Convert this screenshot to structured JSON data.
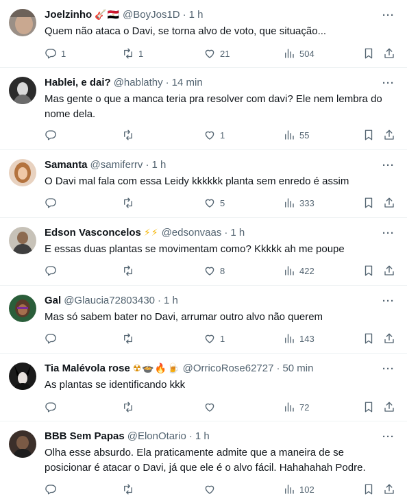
{
  "colors": {
    "text": "#0f1419",
    "secondary": "#536471",
    "divider": "#eff3f4"
  },
  "icons": {
    "reply": "reply-icon",
    "retweet": "retweet-icon",
    "like": "heart-icon",
    "views": "views-icon",
    "bookmark": "bookmark-icon",
    "share": "share-icon",
    "more": "more-icon"
  },
  "tweets": [
    {
      "name": "Joelzinho",
      "emoji": "🎸🇪🇬",
      "handle": "@BoyJos1D",
      "time": "1 h",
      "text": "Quem não ataca o Davi, se torna alvo de voto, que situação...",
      "replies": "1",
      "retweets": "1",
      "likes": "21",
      "views": "504"
    },
    {
      "name": "Hablei, e dai?",
      "emoji": "",
      "handle": "@hablathy",
      "time": "14 min",
      "text": "Mas gente o que a manca teria pra resolver com davi? Ele nem lembra do nome dela.",
      "replies": "",
      "retweets": "",
      "likes": "1",
      "views": "55"
    },
    {
      "name": "Samanta",
      "emoji": "",
      "handle": "@samiferrv",
      "time": "1 h",
      "text": "O Davi mal fala com essa Leidy kkkkkk planta sem enredo é assim",
      "replies": "",
      "retweets": "",
      "likes": "5",
      "views": "333"
    },
    {
      "name": "Edson Vasconcelos",
      "emoji": "⚡⚡",
      "handle": "@edsonvaas",
      "time": "1 h",
      "text": "E essas duas plantas se movimentam como? Kkkkk ah me poupe",
      "replies": "",
      "retweets": "",
      "likes": "8",
      "views": "422"
    },
    {
      "name": "Gal",
      "emoji": "",
      "handle": "@Glaucia72803430",
      "time": "1 h",
      "text": "Mas só sabem bater no Davi, arrumar outro alvo não querem",
      "replies": "",
      "retweets": "",
      "likes": "1",
      "views": "143"
    },
    {
      "name": "Tia Malévola rose",
      "emoji": "☢🍲🔥🍺",
      "handle": "@OrricoRose62727",
      "time": "50 min",
      "text": "As plantas se identificando kkk",
      "replies": "",
      "retweets": "",
      "likes": "",
      "views": "72"
    },
    {
      "name": "BBB Sem Papas",
      "emoji": "",
      "handle": "@ElonOtario",
      "time": "1 h",
      "text": "Olha esse absurdo. Ela praticamente admite que a maneira de se posicionar é atacar o Davi, já que ele é o alvo fácil. Hahahahah Podre.",
      "replies": "",
      "retweets": "",
      "likes": "",
      "views": "102"
    }
  ]
}
